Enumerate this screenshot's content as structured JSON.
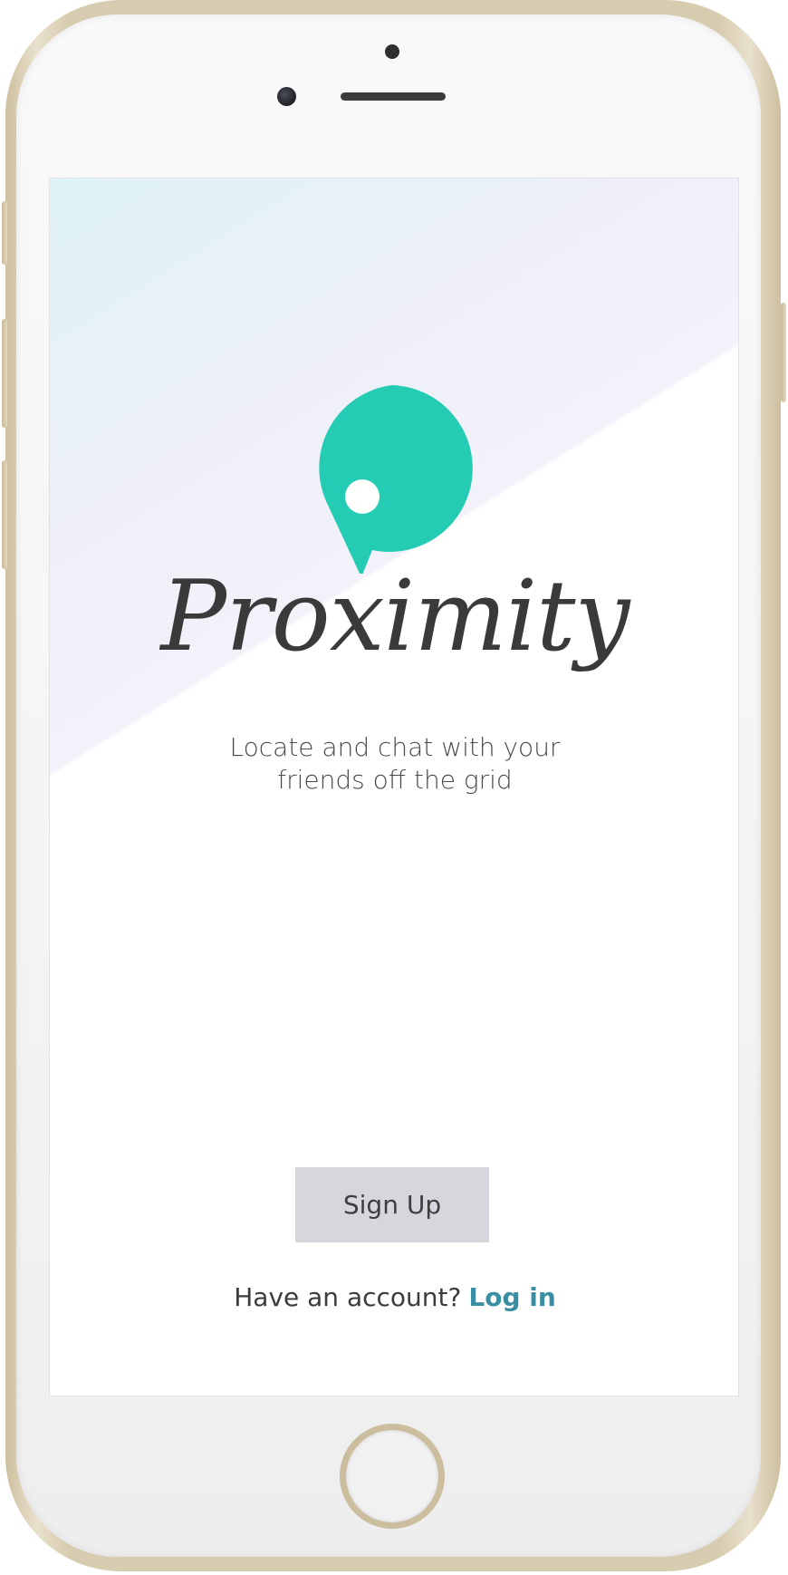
{
  "app": {
    "name": "Proximity",
    "tagline_line1": "Locate and chat with your",
    "tagline_line2": "friends off the grid"
  },
  "actions": {
    "signup_label": "Sign Up",
    "login_prompt": "Have an account?",
    "login_label": "Log in"
  },
  "icons": {
    "logo": "location-pin-chat-bubble-icon"
  },
  "colors": {
    "brand_accent": "#25ccb4",
    "link": "#3a8ea3",
    "button_bg": "#d7d6dc",
    "text": "#3a3a3a",
    "phone_frame": "#d8ccb0"
  }
}
